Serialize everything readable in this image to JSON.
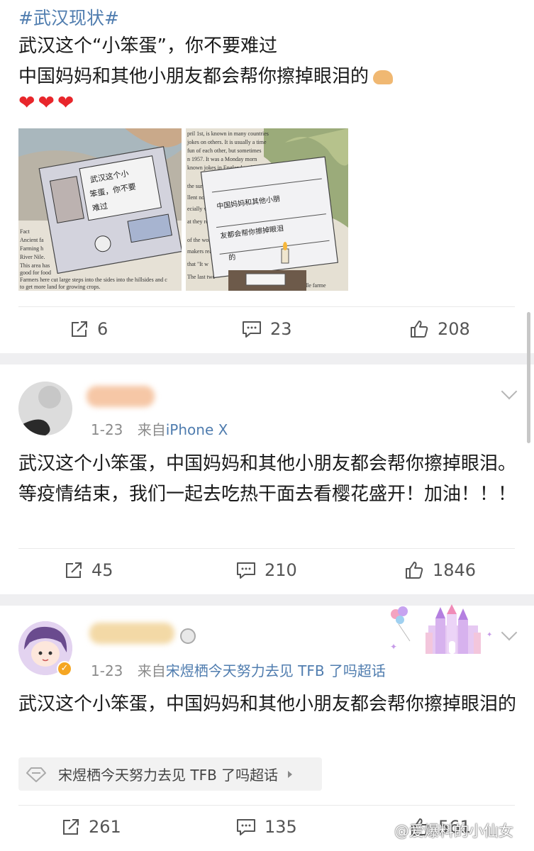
{
  "post": {
    "hashtag": "#武汉现状#",
    "line1": "武汉这个“小笨蛋”，你不要难过",
    "line2": "中国妈妈和其他小朋友都会帮你擦掉眼泪的",
    "hearts": "❤❤❤",
    "images": [
      {
        "handwriting": [
          "武汉这个小",
          "笨蛋，你不要",
          "难过"
        ]
      },
      {
        "handwriting": [
          "中国妈妈和其他小朋",
          "友都会帮你擦掉眼泪",
          "的"
        ]
      }
    ],
    "book_text_left": [
      "Fact",
      "Ancient fa",
      "Farming h",
      "River Nile.",
      "This area has",
      "good for food",
      "Farmers here cut large steps into the sides into the hillsides and c",
      "to get more land for growing crops."
    ],
    "book_text_right": [
      "pril 1st, is known in many countries",
      "jokes on others. It is usually a time",
      "fun of each other, but sometimes",
      "n 1957. It was a Monday morn",
      "known jokes in England took place",
      "the surprise",
      "llent no",
      "ecially wa",
      "at they really",
      "of the work",
      "makers really",
      "that \"It w",
      "The last two",
      "e in for noodle farme"
    ],
    "share": "6",
    "comment": "23",
    "like": "208"
  },
  "comment1": {
    "date": "1-23",
    "source_prefix": "来自",
    "source": "iPhone X",
    "text": "武汉这个小笨蛋，中国妈妈和其他小朋友都会帮你擦掉眼泪。等疫情结束，我们一起去吃热干面去看樱花盛开！加油！！！",
    "share": "45",
    "comment": "210",
    "like": "1846"
  },
  "comment2": {
    "date": "1-23",
    "source_prefix": "来自",
    "source": "宋煜栖今天努力去见 TFB 了吗超话",
    "text": "武汉这个小笨蛋，中国妈妈和其他小朋友都会帮你擦掉眼泪的",
    "topic": "宋煜栖今天努力去见 TFB 了吗超话",
    "share": "261",
    "comment": "135",
    "like": "561"
  },
  "watermark": "@爱爆料的小仙女",
  "colors": {
    "link": "#507daf",
    "heart": "#e8262b",
    "meta": "#8b8b8b"
  }
}
